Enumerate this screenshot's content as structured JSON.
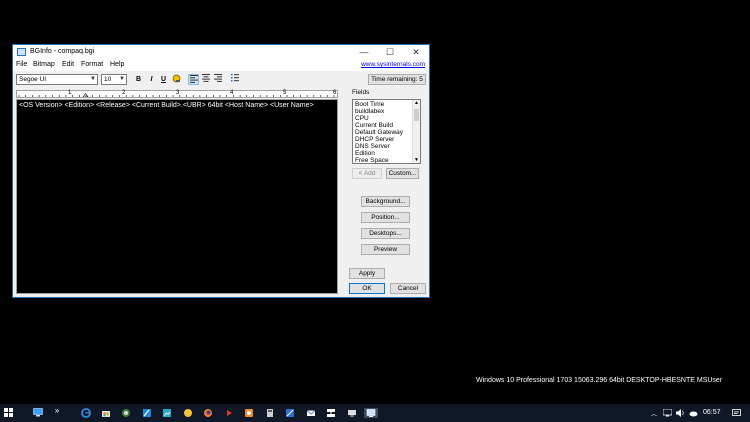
{
  "window": {
    "title": "BGInfo - compaq.bgi",
    "minimize": "—",
    "maximize": "☐",
    "close": "✕"
  },
  "menu": [
    "File",
    "Bitmap",
    "Edit",
    "Format",
    "Help"
  ],
  "link": "www.sysinternals.com",
  "toolbar": {
    "font": "Segoe UI",
    "size": "10",
    "bold": "B",
    "italic": "I",
    "underline": "U",
    "time_remaining": "Time remaining: 5"
  },
  "ruler": [
    "1",
    "2",
    "3",
    "4",
    "5",
    "6"
  ],
  "editor_text": "<OS Version> <Edition> <Release> <Current Build>.<UBR> 64bit <Host Name> <User Name>",
  "fields": {
    "label": "Fields",
    "items": [
      "Boot Time",
      "buildlabex",
      "CPU",
      "Current Build",
      "Default Gateway",
      "DHCP Server",
      "DNS Server",
      "Edition",
      "Free Space"
    ]
  },
  "buttons": {
    "add": "< Add",
    "custom": "Custom...",
    "background": "Background...",
    "position": "Position...",
    "desktops": "Desktops...",
    "preview": "Preview",
    "apply": "Apply",
    "ok": "OK",
    "cancel": "Cancel"
  },
  "desktop_info": "Windows 10 Professional 1703 15063.296 64bit DESKTOP-HBESNTE MSUser",
  "taskbar": {
    "chevron": "»",
    "clock": "06:57"
  },
  "colors": {
    "accent": "#2b6fb3",
    "taskbar": "#101828",
    "link": "#0000ee"
  }
}
